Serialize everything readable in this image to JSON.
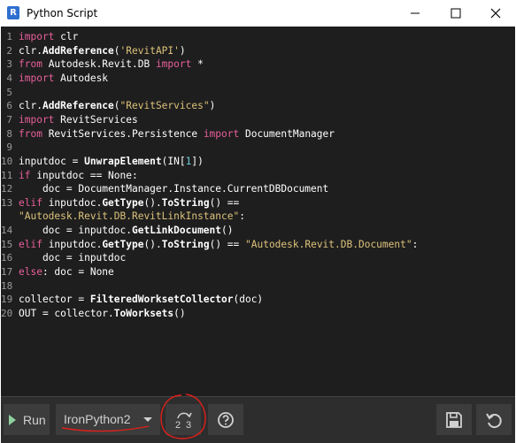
{
  "window": {
    "title": "Python Script",
    "app_icon_letter": "R",
    "minimize_icon": "minimize-icon",
    "maximize_icon": "maximize-icon",
    "close_icon": "close-icon"
  },
  "editor": {
    "line_numbers": [
      "1",
      "2",
      "3",
      "4",
      "5",
      "6",
      "7",
      "8",
      "9",
      "10",
      "11",
      "12",
      "13",
      "14",
      "15",
      "16",
      "17",
      "18",
      "19",
      "20"
    ],
    "lines": [
      [
        {
          "t": "import",
          "c": "kw"
        },
        {
          "t": " clr",
          "c": ""
        }
      ],
      [
        {
          "t": "clr.",
          "c": ""
        },
        {
          "t": "AddReference",
          "c": "fn"
        },
        {
          "t": "(",
          "c": ""
        },
        {
          "t": "'RevitAPI'",
          "c": "str"
        },
        {
          "t": ")",
          "c": ""
        }
      ],
      [
        {
          "t": "from",
          "c": "kw"
        },
        {
          "t": " Autodesk.Revit.DB ",
          "c": ""
        },
        {
          "t": "import",
          "c": "kw"
        },
        {
          "t": " *",
          "c": ""
        }
      ],
      [
        {
          "t": "import",
          "c": "kw"
        },
        {
          "t": " Autodesk",
          "c": ""
        }
      ],
      [],
      [
        {
          "t": "clr.",
          "c": ""
        },
        {
          "t": "AddReference",
          "c": "fn"
        },
        {
          "t": "(",
          "c": ""
        },
        {
          "t": "\"RevitServices\"",
          "c": "str"
        },
        {
          "t": ")",
          "c": ""
        }
      ],
      [
        {
          "t": "import",
          "c": "kw"
        },
        {
          "t": " RevitServices",
          "c": ""
        }
      ],
      [
        {
          "t": "from",
          "c": "kw"
        },
        {
          "t": " RevitServices.Persistence ",
          "c": ""
        },
        {
          "t": "import",
          "c": "kw"
        },
        {
          "t": " DocumentManager",
          "c": ""
        }
      ],
      [],
      [
        {
          "t": "inputdoc = ",
          "c": ""
        },
        {
          "t": "UnwrapElement",
          "c": "fn"
        },
        {
          "t": "(IN[",
          "c": ""
        },
        {
          "t": "1",
          "c": "num"
        },
        {
          "t": "])",
          "c": ""
        }
      ],
      [
        {
          "t": "if",
          "c": "kw"
        },
        {
          "t": " inputdoc == None:",
          "c": ""
        }
      ],
      [
        {
          "t": "    doc = DocumentManager.Instance.CurrentDBDocument",
          "c": ""
        }
      ],
      [
        {
          "t": "elif",
          "c": "kw"
        },
        {
          "t": " inputdoc.",
          "c": ""
        },
        {
          "t": "GetType",
          "c": "fn"
        },
        {
          "t": "().",
          "c": ""
        },
        {
          "t": "ToString",
          "c": "fn"
        },
        {
          "t": "() ==",
          "c": ""
        }
      ],
      [
        {
          "t": "\"Autodesk.Revit.DB.RevitLinkInstance\"",
          "c": "str"
        },
        {
          "t": ":",
          "c": ""
        }
      ],
      [
        {
          "t": "    doc = inputdoc.",
          "c": ""
        },
        {
          "t": "GetLinkDocument",
          "c": "fn"
        },
        {
          "t": "()",
          "c": ""
        }
      ],
      [
        {
          "t": "elif",
          "c": "kw"
        },
        {
          "t": " inputdoc.",
          "c": ""
        },
        {
          "t": "GetType",
          "c": "fn"
        },
        {
          "t": "().",
          "c": ""
        },
        {
          "t": "ToString",
          "c": "fn"
        },
        {
          "t": "() == ",
          "c": ""
        },
        {
          "t": "\"Autodesk.Revit.DB.Document\"",
          "c": "str"
        },
        {
          "t": ":",
          "c": ""
        }
      ],
      [
        {
          "t": "    doc = inputdoc",
          "c": ""
        }
      ],
      [
        {
          "t": "else",
          "c": "kw"
        },
        {
          "t": ": doc = None",
          "c": ""
        }
      ],
      [],
      [
        {
          "t": "collector = ",
          "c": ""
        },
        {
          "t": "FilteredWorksetCollector",
          "c": "fn"
        },
        {
          "t": "(doc)",
          "c": ""
        }
      ],
      [
        {
          "t": "OUT = collector.",
          "c": ""
        },
        {
          "t": "ToWorksets",
          "c": "fn"
        },
        {
          "t": "()",
          "c": ""
        }
      ]
    ],
    "line_number_map": [
      0,
      1,
      2,
      3,
      4,
      5,
      6,
      7,
      8,
      9,
      10,
      11,
      12,
      -1,
      13,
      14,
      15,
      16,
      17,
      18,
      19
    ]
  },
  "toolbar": {
    "run_label": "Run",
    "run_icon": "play-icon",
    "engine_value": "IronPython2",
    "migrate_icon": "python-migration-icon",
    "migrate_digits": [
      "2",
      "3"
    ],
    "help_icon": "help-icon",
    "save_icon": "save-icon",
    "revert_icon": "revert-icon"
  },
  "colors": {
    "editor_bg": "#1e1e1e",
    "keyword": "#e85f9c",
    "string": "#ddc27a",
    "number": "#6ec9d6",
    "toolbar_bg": "#2d2d2d",
    "annotation_red": "#e0201b"
  }
}
